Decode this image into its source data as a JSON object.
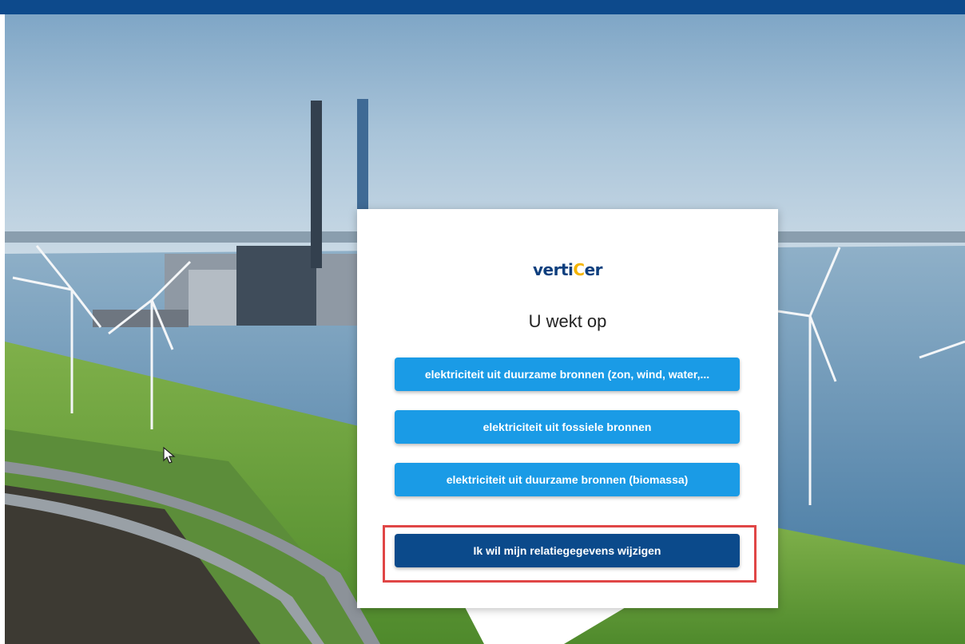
{
  "brand": {
    "logo_before": "verti",
    "logo_c": "C",
    "logo_after": "er"
  },
  "prompt": "U wekt op",
  "options": [
    "elektriciteit uit duurzame bronnen (zon, wind, water,...",
    "elektriciteit uit fossiele bronnen",
    "elektriciteit uit duurzame bronnen (biomassa)"
  ],
  "change_details_label": "Ik wil mijn relatiegegevens wijzigen",
  "colors": {
    "top_bar": "#0d4a8c",
    "primary_light": "#1a9be6",
    "primary_dark": "#0b4a8b",
    "highlight": "#e04646"
  }
}
